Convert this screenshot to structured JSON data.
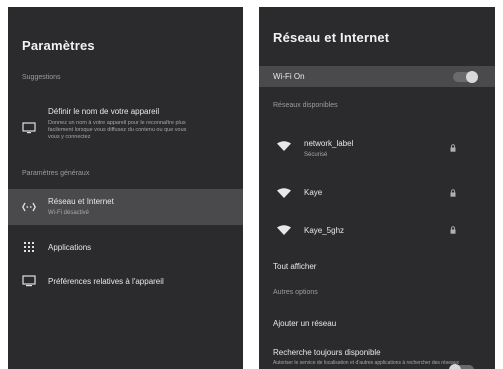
{
  "left": {
    "title": "Paramètres",
    "section_suggestions": "Suggestions",
    "suggestion": {
      "title": "Définir le nom de votre appareil",
      "subtitle_1": "Donnez un nom à votre appareil pour le reconnaître plus",
      "subtitle_2": "facilement lorsque vous diffusez du contenu ou que vous",
      "subtitle_3": "vous y connectez"
    },
    "section_general": "Paramètres généraux",
    "items": [
      {
        "label": "Réseau et Internet",
        "subtitle": "Wi-Fi désactivé",
        "icon": "network-icon"
      },
      {
        "label": "Applications",
        "subtitle": "",
        "icon": "apps-grid-icon"
      },
      {
        "label": "Préférences relatives à l'appareil",
        "subtitle": "",
        "icon": "tv-icon"
      }
    ]
  },
  "right": {
    "title": "Réseau et Internet",
    "wifi_label": "Wi-Fi On",
    "wifi_state": "on",
    "section_networks": "Réseaux disponibles",
    "networks": [
      {
        "name": "network_label",
        "subtitle": "Sécurisé",
        "icon": "wifi-icon",
        "locked": true
      },
      {
        "name": "Kaye",
        "subtitle": "",
        "icon": "wifi-icon",
        "locked": true
      },
      {
        "name": "Kaye_5ghz",
        "subtitle": "",
        "icon": "wifi-icon",
        "locked": true
      }
    ],
    "show_all": "Tout afficher",
    "section_other": "Autres options",
    "add_network": "Ajouter un réseau",
    "scan_always": "Recherche toujours disponible",
    "scan_always_sub": "Autoriser le service de localisation et d'autres applications à rechercher des réseaux",
    "scan_state": "off"
  },
  "colors": {
    "panel_bg": "#2b2b2d",
    "selected_bg": "#4a4a4c",
    "text": "#e8e8e8",
    "muted": "#9c9c9c"
  }
}
